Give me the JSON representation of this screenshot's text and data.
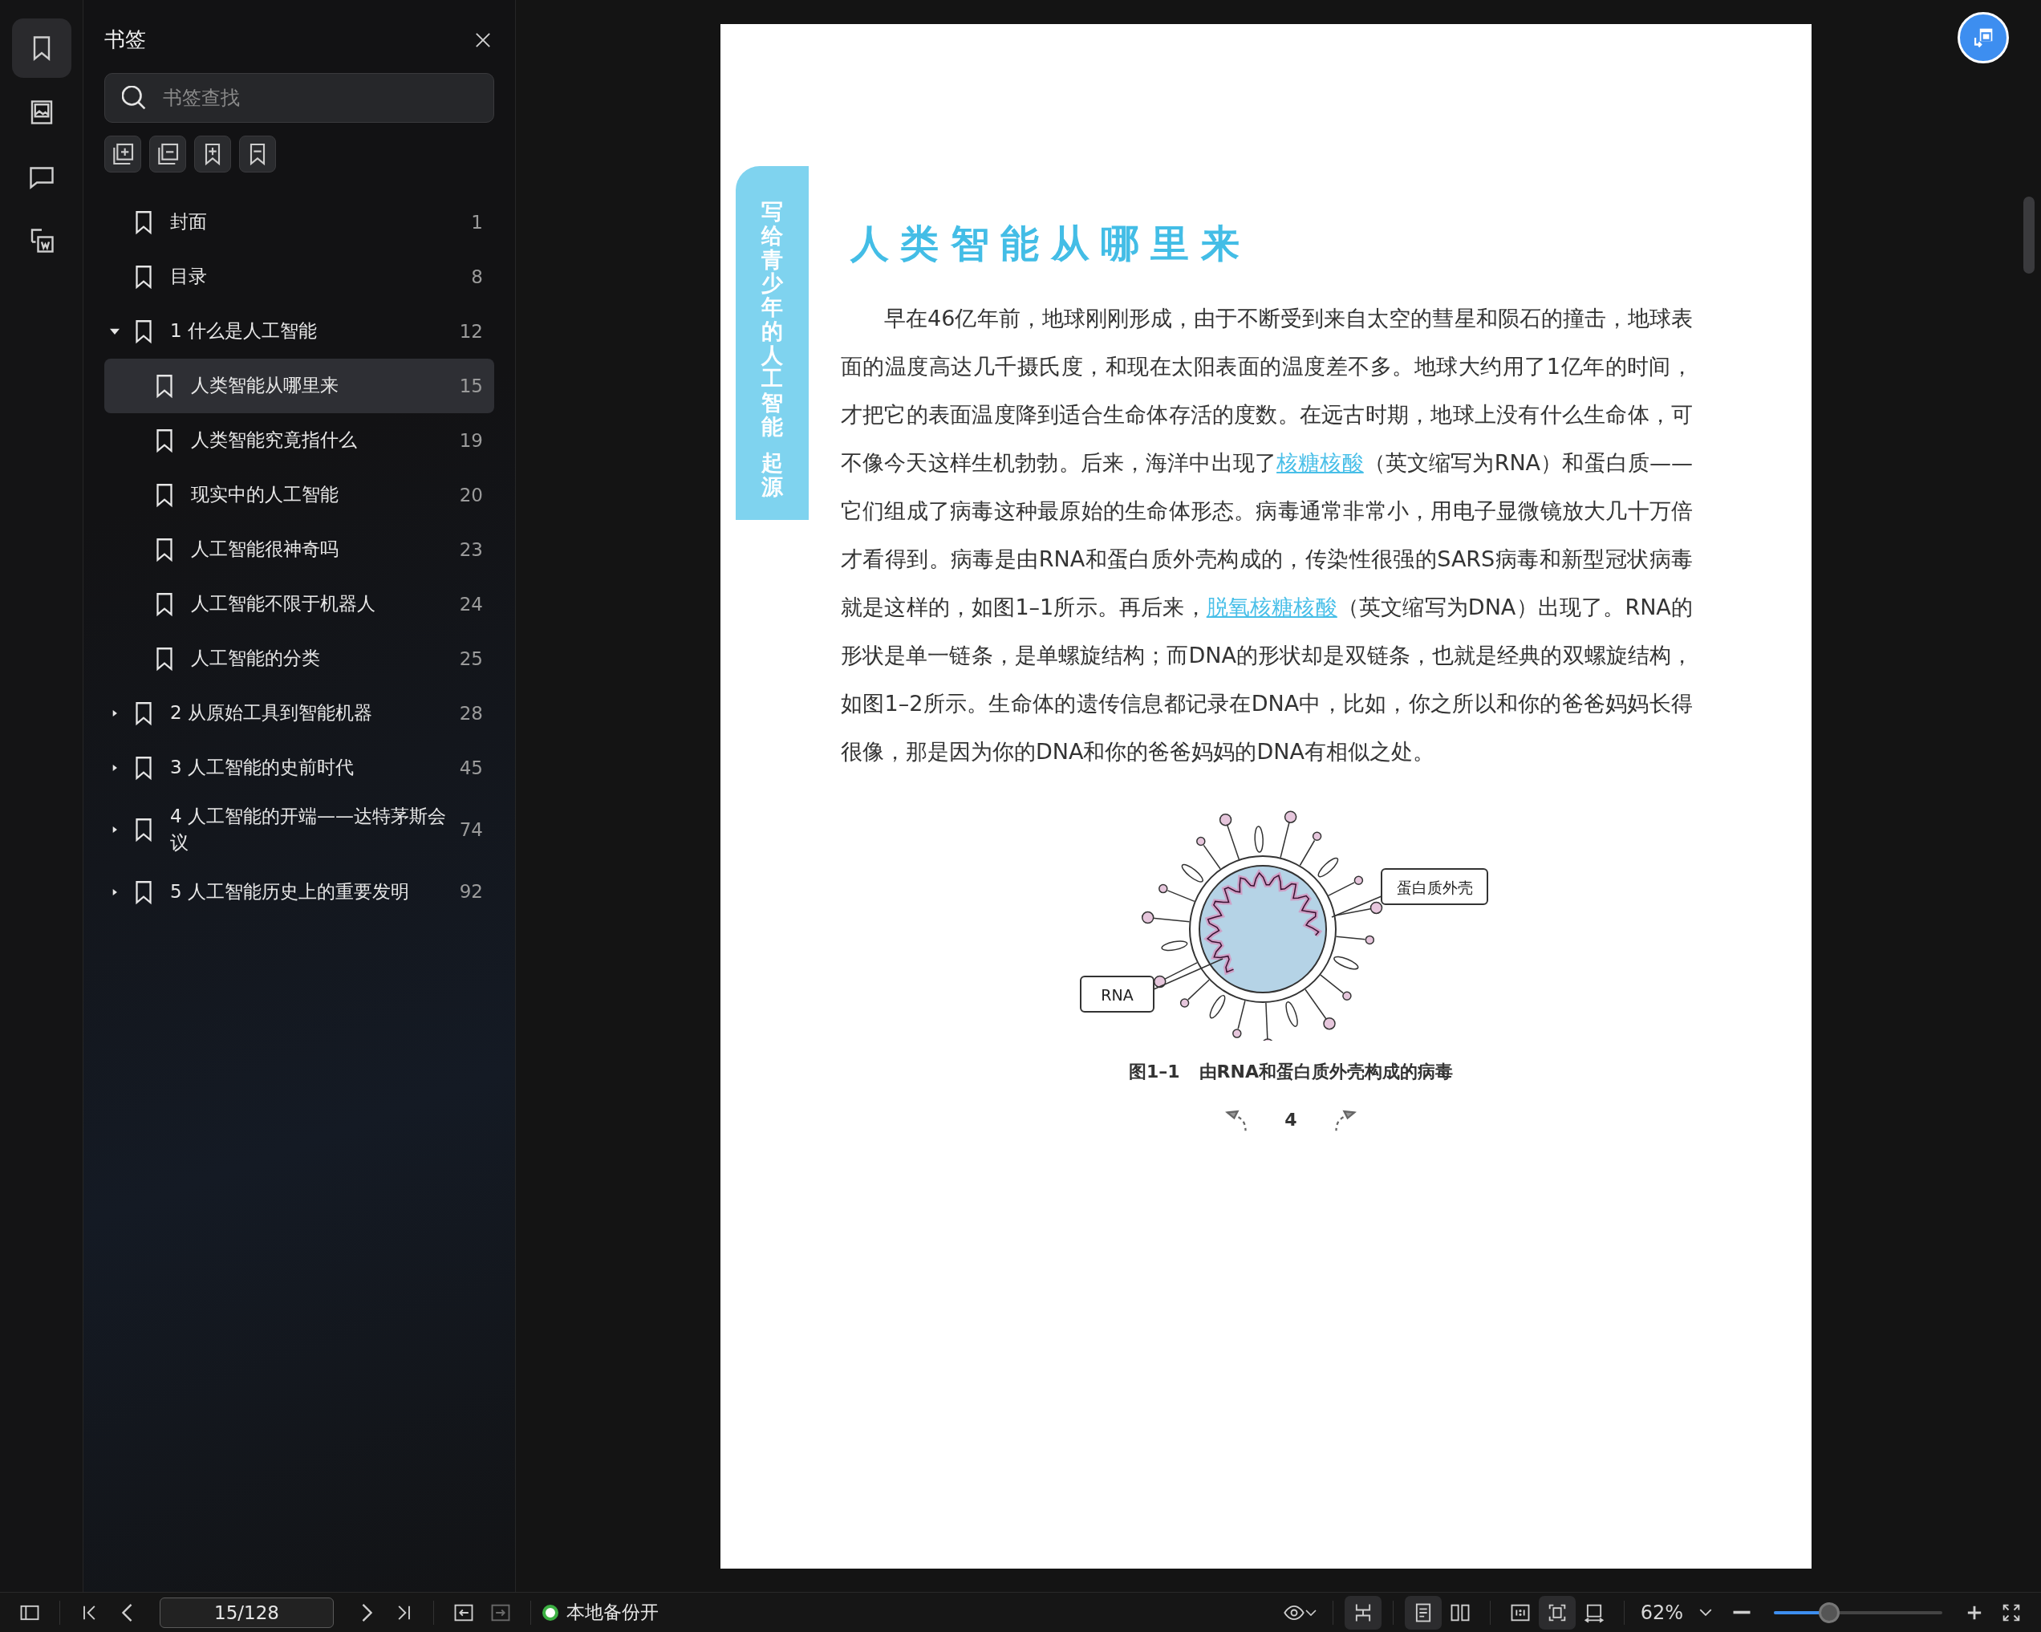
{
  "rail": [
    {
      "kind": "bookmarks",
      "selected": true
    },
    {
      "kind": "images",
      "selected": false
    },
    {
      "kind": "comments",
      "selected": false
    },
    {
      "kind": "export",
      "selected": false
    }
  ],
  "sidebar": {
    "title": "书签",
    "search": {
      "placeholder": "书签查找"
    },
    "tools": [
      {
        "kind": "expand-all"
      },
      {
        "kind": "collapse-all"
      },
      {
        "kind": "add"
      },
      {
        "kind": "remove"
      }
    ],
    "items": [
      {
        "label": "封面",
        "page": "1",
        "selected": false
      },
      {
        "label": "目录",
        "page": "8",
        "selected": false
      },
      {
        "label": "1 什么是人工智能",
        "page": "12",
        "selected": false,
        "expanded": true,
        "children": [
          {
            "label": "人类智能从哪里来",
            "page": "15",
            "selected": true
          },
          {
            "label": "人类智能究竟指什么",
            "page": "19",
            "selected": false
          },
          {
            "label": "现实中的人工智能",
            "page": "20",
            "selected": false
          },
          {
            "label": "人工智能很神奇吗",
            "page": "23",
            "selected": false
          },
          {
            "label": "人工智能不限于机器人",
            "page": "24",
            "selected": false
          },
          {
            "label": "人工智能的分类",
            "page": "25",
            "selected": false
          }
        ]
      },
      {
        "label": "2 从原始工具到智能机器",
        "page": "28",
        "selected": false,
        "expanded": false
      },
      {
        "label": "3 人工智能的史前时代",
        "page": "45",
        "selected": false,
        "expanded": false
      },
      {
        "label": "4 人工智能的开端——达特茅斯会议",
        "page": "74",
        "selected": false,
        "expanded": false
      },
      {
        "label": "5 人工智能历史上的重要发明",
        "page": "92",
        "selected": false,
        "expanded": false
      }
    ]
  },
  "page": {
    "side_tab": [
      "写给青少年的人工智能",
      "起源"
    ],
    "title": "人类智能从哪里来",
    "paragraph": [
      {
        "kind": "text",
        "text": "早在46亿年前，地球刚刚形成，由于不断受到来自太空的彗星和陨石的撞击，地球表面的温度高达几千摄氏度，和现在太阳表面的温度差不多。地球大约用了1亿年的时间，才把它的表面温度降到适合生命体存活的度数。在远古时期，地球上没有什么生命体，可不像今天这样生机勃勃。后来，海洋中出现了"
      },
      {
        "kind": "link",
        "text": "核糖核酸"
      },
      {
        "kind": "text",
        "text": "（英文缩写为RNA）和蛋白质——它们组成了病毒这种最原始的生命体形态。病毒通常非常小，用电子显微镜放大几十万倍才看得到。病毒是由RNA和蛋白质外壳构成的，传染性很强的SARS病毒和新型冠状病毒就是这样的，如图1–1所示。再后来，"
      },
      {
        "kind": "link",
        "text": "脱氧核糖核酸"
      },
      {
        "kind": "text",
        "text": "（英文缩写为DNA）出现了。RNA的形状是单一链条，是单螺旋结构；而DNA的形状却是双链条，也就是经典的双螺旋结构，如图1–2所示。生命体的遗传信息都记录在DNA中，比如，你之所以和你的爸爸妈妈长得很像，那是因为你的DNA和你的爸爸妈妈的DNA有相似之处。"
      }
    ],
    "figure": {
      "labels": [
        "蛋白质外壳",
        "RNA"
      ],
      "number": "图1–1",
      "caption": "由RNA和蛋白质外壳构成的病毒"
    },
    "page_number": "4"
  },
  "status_bar": {
    "page_field": {
      "value": "15/128"
    },
    "back": {
      "disabled": false
    },
    "forward": {
      "disabled": true
    },
    "backup": {
      "label": "本地备份开",
      "on": true
    },
    "scroll_mode": {
      "on": true
    },
    "page_modes": [
      {
        "kind": "single",
        "selected": true
      },
      {
        "kind": "double",
        "selected": false
      }
    ],
    "fit_modes": [
      {
        "kind": "actual-size",
        "selected": false
      },
      {
        "kind": "fit-page",
        "selected": true
      },
      {
        "kind": "fit-width",
        "selected": false
      }
    ],
    "zoom": {
      "value": "62%"
    },
    "zoom_slider": {
      "level": 0.33
    }
  }
}
